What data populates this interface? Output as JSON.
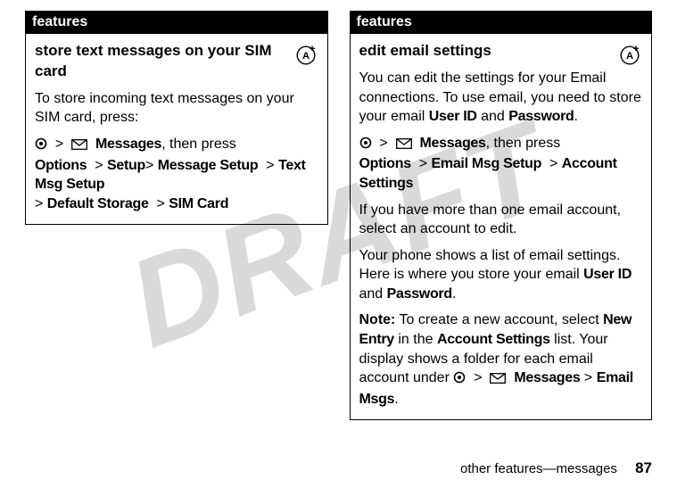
{
  "watermark": "DRAFT",
  "left": {
    "header": "features",
    "title": "store text messages on your SIM card",
    "intro": "To store incoming text messages on your SIM card, press:",
    "path_parts": {
      "messages_label": "Messages",
      "then_press": ", then press",
      "options": "Options",
      "setup": "Setup",
      "message_setup": "Message Setup",
      "text_msg_setup": "Text Msg Setup",
      "default_storage": "Default Storage",
      "sim_card": "SIM Card"
    }
  },
  "right": {
    "header": "features",
    "title": "edit email settings",
    "p1_a": "You can edit the settings for your Email connections. To use email, you need to store your email ",
    "p1_userid": "User ID",
    "p1_b": " and ",
    "p1_password": "Password",
    "p1_c": ".",
    "path_parts": {
      "messages_label": "Messages",
      "then_press": ", then press",
      "options": "Options",
      "email_msg_setup": "Email Msg Setup",
      "account_settings": "Account Settings"
    },
    "p2": "If you have more than one email account, select an account to edit.",
    "p3_a": "Your phone shows a list of email settings. Here is where you store your email ",
    "p3_userid": "User ID",
    "p3_b": " and ",
    "p3_password": "Password",
    "p3_c": ".",
    "note_label": "Note:",
    "note_a": " To create a new account, select ",
    "note_new_entry": "New Entry",
    "note_b": " in the ",
    "note_account_settings": "Account Settings",
    "note_c": " list. Your display shows a folder for each email account under ",
    "note_messages": "Messages",
    "note_d": " > ",
    "note_email_msgs": "Email Msgs",
    "note_e": "."
  },
  "footer": {
    "section": "other features—messages",
    "page": "87"
  },
  "glyphs": {
    "center_key": "s",
    "envelope": "e"
  }
}
